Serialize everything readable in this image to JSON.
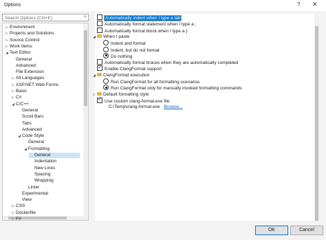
{
  "window": {
    "title": "Options",
    "help_glyph": "?",
    "close_glyph": "✕"
  },
  "search": {
    "placeholder": "Search Options (Ctrl+E)"
  },
  "tree": [
    {
      "label": "Environment",
      "arrow": "▷",
      "indent": 0
    },
    {
      "label": "Projects and Solutions",
      "arrow": "▷",
      "indent": 0
    },
    {
      "label": "Source Control",
      "arrow": "▷",
      "indent": 0
    },
    {
      "label": "Work Items",
      "arrow": "▷",
      "indent": 0
    },
    {
      "label": "Text Editor",
      "arrow": "◢",
      "indent": 0
    },
    {
      "label": "General",
      "arrow": "",
      "indent": 1
    },
    {
      "label": "Advanced",
      "arrow": "",
      "indent": 1
    },
    {
      "label": "File Extension",
      "arrow": "",
      "indent": 1
    },
    {
      "label": "All Languages",
      "arrow": "▷",
      "indent": 1
    },
    {
      "label": "ASP.NET Web Forms",
      "arrow": "▷",
      "indent": 1
    },
    {
      "label": "Basic",
      "arrow": "▷",
      "indent": 1
    },
    {
      "label": "C#",
      "arrow": "▷",
      "indent": 1
    },
    {
      "label": "C/C++",
      "arrow": "◢",
      "indent": 1
    },
    {
      "label": "General",
      "arrow": "",
      "indent": 2
    },
    {
      "label": "Scroll Bars",
      "arrow": "",
      "indent": 2
    },
    {
      "label": "Tabs",
      "arrow": "",
      "indent": 2
    },
    {
      "label": "Advanced",
      "arrow": "",
      "indent": 2
    },
    {
      "label": "Code Style",
      "arrow": "◢",
      "indent": 2
    },
    {
      "label": "General",
      "arrow": "",
      "indent": 3
    },
    {
      "label": "Formatting",
      "arrow": "◢",
      "indent": 3
    },
    {
      "label": "General",
      "arrow": "",
      "indent": 4,
      "selected": true
    },
    {
      "label": "Indentation",
      "arrow": "",
      "indent": 4
    },
    {
      "label": "New Lines",
      "arrow": "",
      "indent": 4
    },
    {
      "label": "Spacing",
      "arrow": "",
      "indent": 4
    },
    {
      "label": "Wrapping",
      "arrow": "",
      "indent": 4
    },
    {
      "label": "Linter",
      "arrow": "",
      "indent": 3
    },
    {
      "label": "Experimental",
      "arrow": "",
      "indent": 2
    },
    {
      "label": "View",
      "arrow": "",
      "indent": 2
    },
    {
      "label": "CSS",
      "arrow": "▷",
      "indent": 1
    },
    {
      "label": "Dockerfile",
      "arrow": "▷",
      "indent": 1
    },
    {
      "label": "F#",
      "arrow": "▷",
      "indent": 1
    }
  ],
  "options": [
    {
      "kind": "checkbox",
      "label": "Automatically indent when I type a tab",
      "checked": false,
      "indent": 0,
      "focused": true
    },
    {
      "kind": "checkbox",
      "label": "Automatically format statement when I type a ;",
      "checked": false,
      "indent": 0
    },
    {
      "kind": "checkbox",
      "label": "Automatically format block when I type a }",
      "checked": false,
      "indent": 0
    },
    {
      "kind": "group",
      "label": "When I paste",
      "expanded": true,
      "indent": 0
    },
    {
      "kind": "radio",
      "label": "Indent and format",
      "checked": false,
      "indent": 1
    },
    {
      "kind": "radio",
      "label": "Indent, but do not format",
      "checked": false,
      "indent": 1
    },
    {
      "kind": "radio",
      "label": "Do nothing",
      "checked": true,
      "indent": 1
    },
    {
      "kind": "checkbox",
      "label": "Automatically format braces when they are automatically completed",
      "checked": false,
      "indent": 0
    },
    {
      "kind": "checkbox",
      "label": "Enable ClangFormat support",
      "checked": true,
      "indent": 0
    },
    {
      "kind": "group",
      "label": "ClangFormat execution",
      "expanded": true,
      "indent": 0
    },
    {
      "kind": "radio",
      "label": "Run ClangFormat for all formatting scenarios",
      "checked": false,
      "indent": 1
    },
    {
      "kind": "radio",
      "label": "Run ClangFormat only for manually invoked formatting commands",
      "checked": true,
      "indent": 1
    },
    {
      "kind": "group",
      "label": "Default formatting style",
      "expanded": false,
      "indent": 0
    },
    {
      "kind": "checkbox",
      "label": "Use custom clang-format.exe file",
      "checked": true,
      "indent": 0
    },
    {
      "kind": "path",
      "label": "C:\\Temp\\clang-format.exe",
      "link": "Browse...",
      "indent": 1
    }
  ],
  "buttons": {
    "ok": "OK",
    "cancel": "Cancel"
  }
}
